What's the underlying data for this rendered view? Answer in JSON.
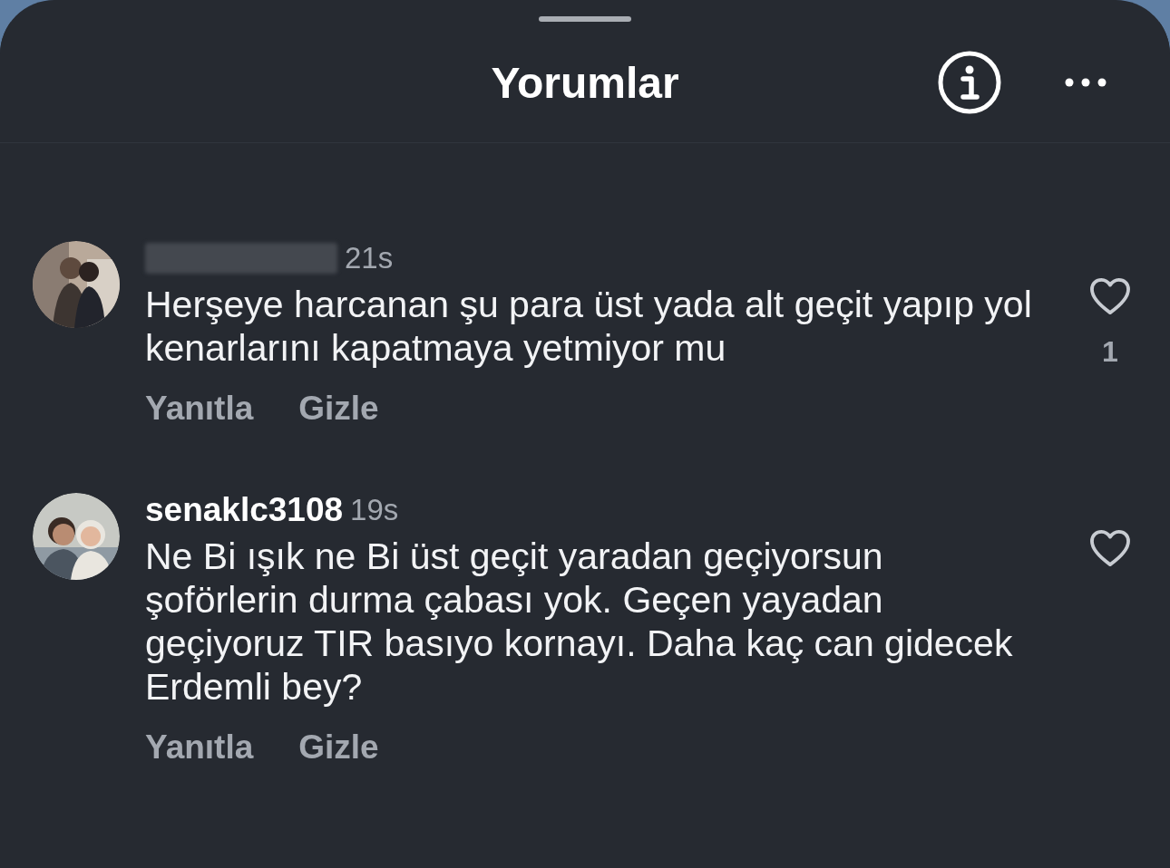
{
  "sheet": {
    "title": "Yorumlar"
  },
  "comments": [
    {
      "username_redacted": true,
      "time": "21s",
      "text": "Herşeye harcanan şu para üst yada alt geçit yapıp yol kenarlarını kapatmaya yetmiyor mu",
      "liked": false,
      "like_count": "1",
      "actions": [
        "Yanıtla",
        "Gizle"
      ]
    },
    {
      "username_redacted": false,
      "username": "senaklc3108",
      "time": "19s",
      "text": "Ne Bi ışık ne Bi üst geçit yaradan geçiyorsun şoförlerin durma çabası yok. Geçen yayadan geçiyoruz TIR basıyo kornayı. Daha kaç can gidecek Erdemli bey?",
      "liked": false,
      "actions": [
        "Yanıtla",
        "Gizle"
      ]
    }
  ]
}
